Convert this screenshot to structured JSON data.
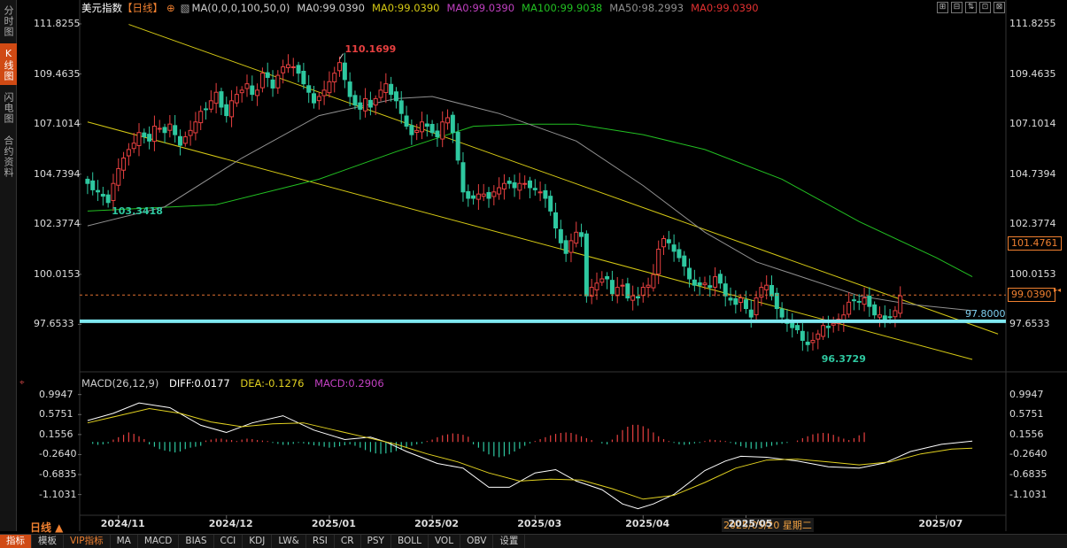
{
  "header": {
    "title": "美元指数",
    "period_tag": "【日线】",
    "ma_params": "MA(0,0,0,100,50,0)",
    "ma_values": [
      {
        "text": "MA0:99.0390",
        "color": "#cccccc"
      },
      {
        "text": "MA0:99.0390",
        "color": "#d4c814"
      },
      {
        "text": "MA0:99.0390",
        "color": "#c040c0"
      },
      {
        "text": "MA100:99.9038",
        "color": "#22c022"
      },
      {
        "text": "MA50:98.2993",
        "color": "#909090"
      },
      {
        "text": "MA0:99.0390",
        "color": "#e03030"
      }
    ]
  },
  "left_tabs": [
    {
      "label": "分时图",
      "active": false
    },
    {
      "label": "K线图",
      "active": true
    },
    {
      "label": "闪电图",
      "active": false
    },
    {
      "label": "合约资料",
      "active": false
    }
  ],
  "window_icons": [
    "⊞",
    "⊟",
    "⇅",
    "⊡",
    "⊠"
  ],
  "period_label": "日线 ▲",
  "bottom_tabs": [
    {
      "label": "指标",
      "style": "active"
    },
    {
      "label": "模板",
      "style": "normal"
    },
    {
      "label": "VIP指标",
      "style": "orange"
    },
    {
      "label": "MA",
      "style": "normal"
    },
    {
      "label": "MACD",
      "style": "normal"
    },
    {
      "label": "BIAS",
      "style": "normal"
    },
    {
      "label": "CCI",
      "style": "normal"
    },
    {
      "label": "KDJ",
      "style": "normal"
    },
    {
      "label": "LW&",
      "style": "normal"
    },
    {
      "label": "RSI",
      "style": "normal"
    },
    {
      "label": "CR",
      "style": "normal"
    },
    {
      "label": "PSY",
      "style": "normal"
    },
    {
      "label": "BOLL",
      "style": "normal"
    },
    {
      "label": "VOL",
      "style": "normal"
    },
    {
      "label": "OBV",
      "style": "normal"
    },
    {
      "label": "设置",
      "style": "normal"
    }
  ],
  "date_hover": "2025/05/20 星期二",
  "chart_data": [
    {
      "type": "candlestick",
      "title": "美元指数",
      "y_ticks": [
        "111.8255",
        "109.4635",
        "107.1014",
        "104.7394",
        "102.3774",
        "100.0153",
        "97.6533"
      ],
      "y_tick_values": [
        111.8255,
        109.4635,
        107.1014,
        104.7394,
        102.3774,
        100.0153,
        97.6533
      ],
      "ylim": [
        95.5,
        112.2
      ],
      "x_ticks": [
        "2024/11",
        "2024/12",
        "2025/01",
        "2025/02",
        "2025/03",
        "2025/04",
        "2025/05",
        "2025/07"
      ],
      "x_tick_index": [
        6,
        27,
        47,
        67,
        87,
        108,
        128,
        165
      ],
      "closes": [
        104.3,
        104.0,
        103.9,
        103.7,
        103.4,
        104.3,
        105.0,
        105.5,
        105.9,
        106.2,
        106.7,
        106.5,
        106.3,
        107.0,
        106.9,
        106.7,
        107.1,
        106.6,
        106.1,
        106.5,
        106.8,
        107.2,
        107.7,
        107.8,
        108.2,
        108.6,
        107.9,
        107.5,
        108.2,
        108.5,
        108.7,
        109.0,
        108.5,
        108.7,
        109.5,
        109.3,
        108.8,
        109.4,
        109.8,
        109.9,
        109.8,
        109.5,
        109.0,
        108.6,
        108.1,
        108.4,
        108.7,
        109.1,
        109.5,
        110.0,
        109.2,
        108.4,
        108.0,
        107.8,
        108.3,
        107.9,
        108.3,
        108.7,
        109.0,
        108.5,
        108.2,
        107.6,
        107.0,
        106.6,
        106.8,
        107.2,
        107.0,
        106.7,
        106.5,
        107.2,
        107.4,
        106.7,
        105.4,
        103.9,
        103.6,
        103.6,
        103.8,
        103.8,
        103.6,
        103.9,
        104.1,
        104.3,
        104.3,
        104.1,
        104.3,
        104.3,
        104.1,
        104.0,
        103.9,
        103.6,
        103.0,
        102.2,
        101.5,
        101.0,
        101.6,
        102.0,
        101.8,
        99.0,
        99.4,
        99.6,
        99.8,
        99.8,
        99.1,
        99.4,
        99.5,
        98.9,
        99.0,
        98.9,
        99.4,
        99.5,
        100.0,
        101.2,
        101.7,
        101.5,
        101.1,
        100.8,
        100.4,
        99.8,
        99.5,
        99.5,
        99.6,
        99.4,
        99.9,
        99.6,
        99.0,
        98.8,
        98.6,
        98.9,
        98.4,
        98.0,
        98.9,
        99.4,
        99.5,
        99.0,
        98.4,
        98.0,
        97.7,
        97.5,
        97.4,
        96.9,
        96.7,
        96.9,
        97.2,
        97.6,
        97.5,
        97.7,
        97.9,
        98.1,
        98.7,
        98.8,
        98.7,
        98.9,
        98.5,
        98.1,
        98.1,
        97.9,
        98.0,
        98.3,
        99.0
      ],
      "high_marker": {
        "label": "110.1699",
        "value": 110.1699,
        "index": 49
      },
      "low_markers": [
        {
          "label": "103.3418",
          "value": 103.3418,
          "index": 4
        },
        {
          "label": "96.3729",
          "value": 96.3729,
          "index": 142
        }
      ],
      "ma100": {
        "name": "MA100",
        "color": "#22c022",
        "points": [
          [
            0,
            103.0
          ],
          [
            25,
            103.3
          ],
          [
            45,
            104.5
          ],
          [
            60,
            105.8
          ],
          [
            75,
            107.0
          ],
          [
            85,
            107.1
          ],
          [
            95,
            107.1
          ],
          [
            108,
            106.6
          ],
          [
            120,
            105.9
          ],
          [
            135,
            104.5
          ],
          [
            150,
            102.5
          ],
          [
            165,
            100.8
          ],
          [
            172,
            99.9
          ]
        ]
      },
      "ma50": {
        "name": "MA50",
        "color": "#909090",
        "points": [
          [
            0,
            102.3
          ],
          [
            15,
            103.2
          ],
          [
            30,
            105.5
          ],
          [
            45,
            107.5
          ],
          [
            60,
            108.3
          ],
          [
            67,
            108.4
          ],
          [
            80,
            107.6
          ],
          [
            95,
            106.3
          ],
          [
            108,
            104.2
          ],
          [
            120,
            102.0
          ],
          [
            130,
            100.6
          ],
          [
            140,
            99.8
          ],
          [
            150,
            99.0
          ],
          [
            160,
            98.6
          ],
          [
            172,
            98.3
          ]
        ]
      },
      "trendlines": [
        {
          "from": [
            0,
            107.2
          ],
          "to": [
            172,
            96.0
          ],
          "color": "#d4c814"
        },
        {
          "from": [
            8,
            111.8
          ],
          "to": [
            177,
            97.2
          ],
          "color": "#d4c814"
        }
      ],
      "support_line": {
        "value": 97.8,
        "label": "97.8000",
        "color": "#7fe8f0"
      },
      "resistance_tag": {
        "label": "101.4761",
        "value": 101.4761
      },
      "last_price": {
        "label": "99.0390",
        "value": 99.039
      },
      "current_price": "99.0390"
    },
    {
      "type": "macd",
      "title": "MACD(26,12,9)",
      "diff": {
        "label": "DIFF:0.0177",
        "value": 0.0177,
        "color": "#ffffff"
      },
      "dea": {
        "label": "DEA:-0.1276",
        "value": -0.1276,
        "color": "#e0d020"
      },
      "macd": {
        "label": "MACD:0.2906",
        "value": 0.2906,
        "color": "#c040c0"
      },
      "y_ticks": [
        "0.9947",
        "0.5751",
        "0.1556",
        "-0.2640",
        "-0.6835",
        "-1.1031"
      ],
      "y_tick_values": [
        0.9947,
        0.5751,
        0.1556,
        -0.264,
        -0.6835,
        -1.1031
      ],
      "ylim": [
        -1.5,
        1.1
      ],
      "diff_points": [
        [
          0,
          0.45
        ],
        [
          5,
          0.6
        ],
        [
          10,
          0.82
        ],
        [
          16,
          0.72
        ],
        [
          22,
          0.35
        ],
        [
          27,
          0.2
        ],
        [
          32,
          0.4
        ],
        [
          38,
          0.55
        ],
        [
          44,
          0.25
        ],
        [
          50,
          0.05
        ],
        [
          55,
          0.1
        ],
        [
          58,
          0.0
        ],
        [
          62,
          -0.2
        ],
        [
          68,
          -0.45
        ],
        [
          73,
          -0.55
        ],
        [
          78,
          -0.95
        ],
        [
          82,
          -0.95
        ],
        [
          87,
          -0.65
        ],
        [
          91,
          -0.58
        ],
        [
          95,
          -0.82
        ],
        [
          100,
          -1.0
        ],
        [
          104,
          -1.3
        ],
        [
          107,
          -1.4
        ],
        [
          110,
          -1.3
        ],
        [
          114,
          -1.1
        ],
        [
          120,
          -0.6
        ],
        [
          124,
          -0.4
        ],
        [
          127,
          -0.3
        ],
        [
          132,
          -0.32
        ],
        [
          138,
          -0.4
        ],
        [
          144,
          -0.52
        ],
        [
          150,
          -0.55
        ],
        [
          155,
          -0.44
        ],
        [
          160,
          -0.2
        ],
        [
          166,
          -0.05
        ],
        [
          172,
          0.02
        ]
      ],
      "dea_points": [
        [
          0,
          0.4
        ],
        [
          6,
          0.55
        ],
        [
          12,
          0.7
        ],
        [
          18,
          0.6
        ],
        [
          24,
          0.42
        ],
        [
          30,
          0.32
        ],
        [
          36,
          0.38
        ],
        [
          42,
          0.4
        ],
        [
          48,
          0.25
        ],
        [
          54,
          0.1
        ],
        [
          60,
          -0.05
        ],
        [
          66,
          -0.25
        ],
        [
          72,
          -0.42
        ],
        [
          78,
          -0.65
        ],
        [
          84,
          -0.82
        ],
        [
          90,
          -0.78
        ],
        [
          96,
          -0.8
        ],
        [
          102,
          -0.98
        ],
        [
          108,
          -1.2
        ],
        [
          114,
          -1.12
        ],
        [
          120,
          -0.85
        ],
        [
          126,
          -0.55
        ],
        [
          132,
          -0.38
        ],
        [
          138,
          -0.36
        ],
        [
          144,
          -0.42
        ],
        [
          150,
          -0.48
        ],
        [
          156,
          -0.42
        ],
        [
          162,
          -0.25
        ],
        [
          168,
          -0.15
        ],
        [
          172,
          -0.13
        ]
      ],
      "hist_values": [
        0.0,
        -0.04,
        -0.06,
        -0.05,
        -0.03,
        0.05,
        0.1,
        0.15,
        0.2,
        0.17,
        0.12,
        0.06,
        -0.05,
        -0.1,
        -0.15,
        -0.18,
        -0.2,
        -0.22,
        -0.2,
        -0.15,
        -0.12,
        -0.1,
        -0.08,
        0.03,
        0.05,
        0.07,
        0.07,
        0.05,
        0.04,
        0.02,
        0.05,
        0.07,
        0.06,
        0.04,
        0.03,
        0.02,
        -0.02,
        -0.04,
        -0.06,
        -0.06,
        -0.04,
        -0.02,
        -0.03,
        -0.05,
        -0.07,
        -0.08,
        -0.1,
        -0.12,
        -0.11,
        -0.09,
        -0.07,
        -0.05,
        -0.08,
        -0.12,
        -0.17,
        -0.21,
        -0.24,
        -0.25,
        -0.24,
        -0.22,
        -0.19,
        -0.16,
        -0.12,
        -0.08,
        -0.05,
        -0.03,
        0.02,
        0.05,
        0.1,
        0.14,
        0.16,
        0.18,
        0.17,
        0.15,
        0.11,
        -0.05,
        -0.12,
        -0.2,
        -0.26,
        -0.3,
        -0.32,
        -0.3,
        -0.26,
        -0.2,
        -0.14,
        -0.08,
        -0.03,
        0.02,
        0.06,
        0.1,
        0.14,
        0.17,
        0.19,
        0.2,
        0.19,
        0.16,
        0.12,
        0.08,
        0.04,
        0.0,
        -0.03,
        -0.05,
        0.05,
        0.15,
        0.25,
        0.32,
        0.36,
        0.36,
        0.33,
        0.28,
        0.2,
        0.12,
        0.06,
        0.02,
        -0.02,
        -0.05,
        -0.06,
        -0.05,
        -0.03,
        -0.02,
        0.02,
        0.05,
        0.04,
        0.03,
        0.02,
        -0.02,
        -0.05,
        -0.09,
        -0.12,
        -0.14,
        -0.15,
        -0.13,
        -0.1,
        -0.08,
        -0.06,
        -0.04,
        -0.02,
        0.0,
        0.03,
        0.08,
        0.12,
        0.16,
        0.18,
        0.19,
        0.18,
        0.15,
        0.11,
        0.07,
        0.04,
        0.08,
        0.14,
        0.2
      ]
    }
  ]
}
